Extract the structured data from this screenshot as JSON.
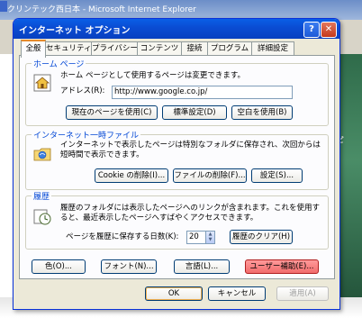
{
  "browser": {
    "window_title": "クリンテック西日本 - Microsoft Internet Explorer"
  },
  "dialog": {
    "title": "インターネット オプション",
    "help_label": "?",
    "close_label": "✕",
    "tabs": [
      "全般",
      "セキュリティ",
      "プライバシー",
      "コンテンツ",
      "接続",
      "プログラム",
      "詳細設定"
    ],
    "home": {
      "group_label": "ホーム ページ",
      "description": "ホーム ページとして使用するページは変更できます。",
      "address_label": "アドレス(R):",
      "address_value": "http://www.google.co.jp/",
      "buttons": [
        "現在のページを使用(C)",
        "標準設定(D)",
        "空白を使用(B)"
      ]
    },
    "temp": {
      "group_label": "インターネット一時ファイル",
      "description_line1": "インターネットで表示したページは特別なフォルダに保存され、次回からは",
      "description_line2": "短時間で表示できます。",
      "buttons": [
        "Cookie の削除(I)...",
        "ファイルの削除(F)...",
        "設定(S)..."
      ]
    },
    "history": {
      "group_label": "履歴",
      "description_line1": "履歴のフォルダには表示したページへのリンクが含まれます。これを使用す",
      "description_line2": "ると、最近表示したページへすばやくアクセスできます。",
      "days_label": "ページを履歴に保存する日数(K):",
      "days_value": "20",
      "clear_button": "履歴のクリア(H)"
    },
    "bottom_buttons": [
      "色(O)...",
      "フォント(N)...",
      "言語(L)...",
      "ユーザー補助(E)..."
    ],
    "ok": "OK",
    "cancel": "キャンセル",
    "apply": "適用(A)"
  }
}
